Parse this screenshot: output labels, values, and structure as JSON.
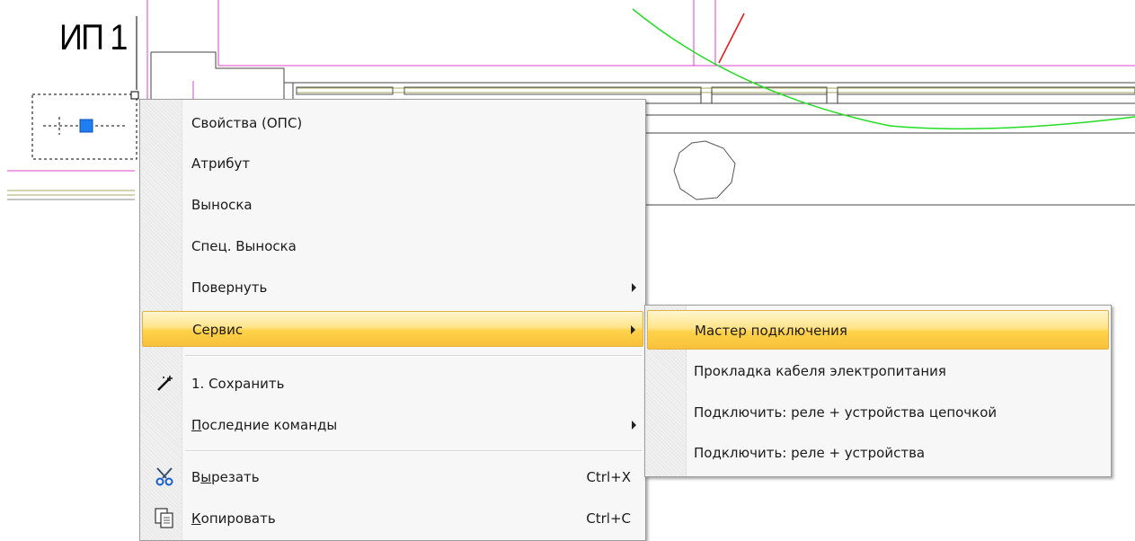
{
  "drawing": {
    "label": "ИП 1"
  },
  "context_menu": {
    "items": [
      {
        "label": "Свойства (ОПС)"
      },
      {
        "label": "Атрибут"
      },
      {
        "label": "Выноска"
      },
      {
        "label": "Спец. Выноска"
      },
      {
        "label": "Повернуть",
        "has_submenu": true
      },
      {
        "label": "Сервис",
        "has_submenu": true,
        "highlighted": true
      },
      {
        "label": "1. Сохранить",
        "icon": "wand-icon"
      },
      {
        "label_pre": "",
        "label_u": "П",
        "label_post": "оследние команды",
        "has_submenu": true
      },
      {
        "label_pre": "В",
        "label_u": "ы",
        "label_post": "резать",
        "shortcut": "Ctrl+X",
        "icon": "scissors-icon"
      },
      {
        "label_pre": "",
        "label_u": "К",
        "label_post": "опировать",
        "shortcut": "Ctrl+C",
        "icon": "copy-icon"
      }
    ]
  },
  "submenu": {
    "items": [
      {
        "label": "Мастер подключения",
        "highlighted": true
      },
      {
        "label": "Прокладка кабеля электропитания"
      },
      {
        "label": "Подключить: реле + устройства цепочкой"
      },
      {
        "label": "Подключить: реле + устройства"
      }
    ]
  },
  "colors": {
    "magenta_line": "#e040c8",
    "green_arc": "#22dd22",
    "red_line": "#ee1111",
    "olive_line": "#a8a860",
    "selection_grip": "#1e7df0",
    "highlight": "#ffd24a"
  }
}
